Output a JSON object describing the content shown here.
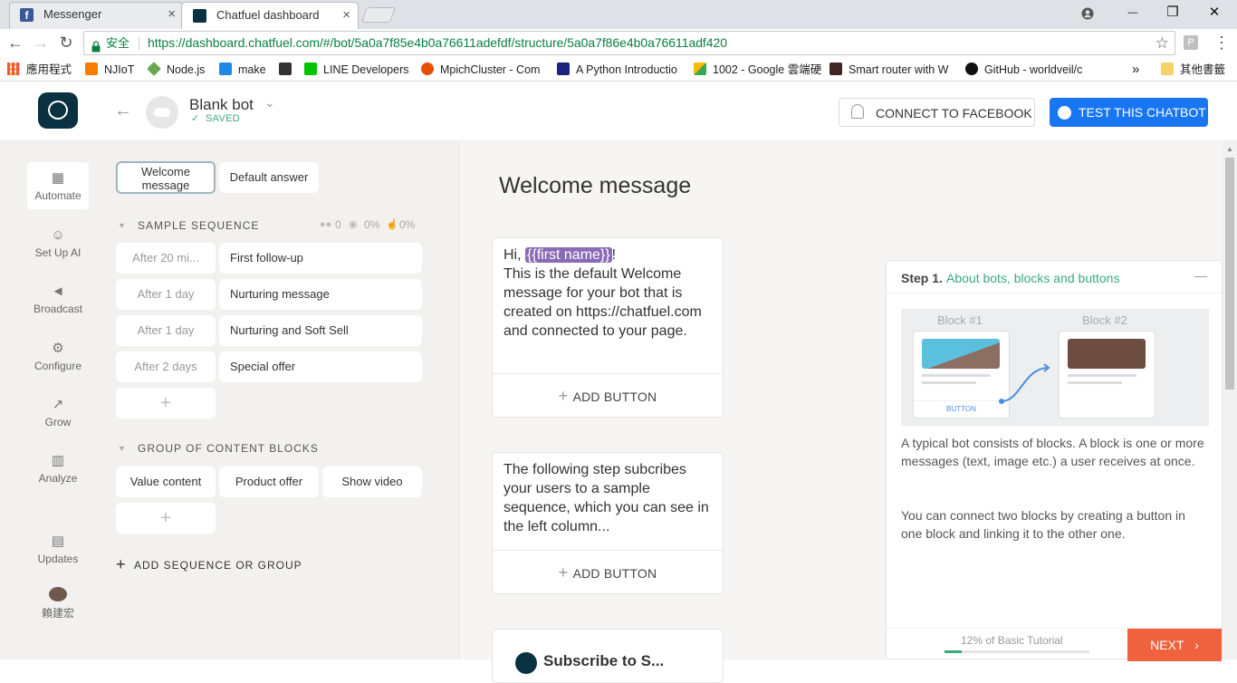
{
  "browser": {
    "tabs": [
      {
        "title": "Messenger",
        "close": "×"
      },
      {
        "title": "Chatfuel dashboard",
        "close": "×"
      }
    ],
    "window_controls": {
      "minimize": "—",
      "maximize": "❐",
      "close": "✕"
    },
    "address": {
      "secure_label": "安全",
      "url": "https://dashboard.chatfuel.com/#/bot/5a0a7f85e4b0a76611adefdf/structure/5a0a7f86e4b0a76611adf420"
    },
    "bookmarks": [
      {
        "label": "應用程式",
        "color": "#e8453c"
      },
      {
        "label": "NJIoT",
        "color": "#f57c00"
      },
      {
        "label": "Node.js",
        "color": "#6aa84f"
      },
      {
        "label": "make",
        "color": "#1e88e5"
      },
      {
        "label": "",
        "color": "#333333"
      },
      {
        "label": "LINE Developers",
        "color": "#00c300"
      },
      {
        "label": "MpichCluster - Com",
        "color": "#e65100"
      },
      {
        "label": "A Python Introductio",
        "color": "#1a237e"
      },
      {
        "label": "1002 - Google 雲端硬",
        "color": "#fbbc05"
      },
      {
        "label": "Smart router with W",
        "color": "#3e2723"
      },
      {
        "label": "GitHub - worldveil/c",
        "color": "#111111"
      }
    ],
    "bookmarks_overflow": "»",
    "other_bookmarks": "其他書籤"
  },
  "header": {
    "bot_name": "Blank bot",
    "status": "SAVED",
    "connect_label": "CONNECT TO FACEBOOK",
    "test_label": "TEST THIS CHATBOT"
  },
  "nav": [
    {
      "label": "Automate",
      "icon": "automate-icon"
    },
    {
      "label": "Set Up AI",
      "icon": "ai-icon"
    },
    {
      "label": "Broadcast",
      "icon": "broadcast-icon"
    },
    {
      "label": "Configure",
      "icon": "gear-icon"
    },
    {
      "label": "Grow",
      "icon": "grow-icon"
    },
    {
      "label": "Analyze",
      "icon": "analyze-icon"
    },
    {
      "label": "Updates",
      "icon": "updates-icon"
    },
    {
      "label": "賴建宏",
      "icon": "avatar"
    }
  ],
  "blocks": {
    "welcome_chip": "Welcome message",
    "default_chip": "Default answer",
    "sequence": {
      "title": "SAMPLE SEQUENCE",
      "stats": {
        "users": "0",
        "views": "0%",
        "clicks": "0%"
      },
      "rows": [
        {
          "delay": "After 20 mi...",
          "name": "First follow-up"
        },
        {
          "delay": "After 1 day",
          "name": "Nurturing message"
        },
        {
          "delay": "After 1 day",
          "name": "Nurturing and Soft Sell"
        },
        {
          "delay": "After 2 days",
          "name": "Special offer"
        }
      ],
      "add": "+"
    },
    "group": {
      "title": "GROUP OF CONTENT BLOCKS",
      "items": [
        "Value content",
        "Product offer",
        "Show video"
      ],
      "add": "+"
    },
    "add_sequence": "ADD SEQUENCE OR GROUP"
  },
  "editor": {
    "title": "Welcome message",
    "card1": {
      "greeting": "Hi, ",
      "tag": "{{first name}}",
      "tag_suffix": "!",
      "body": "This is the default Welcome message for your bot that is created on https://chatfuel.com and connected to your page.",
      "add_button": "ADD BUTTON"
    },
    "card2": {
      "body": "The following step subcribes your users to a sample sequence, which you can see in the left column...",
      "add_button": "ADD BUTTON"
    },
    "card3_title": "Subscribe to S..."
  },
  "tutorial": {
    "step_prefix": "Step 1.",
    "step_title": "About bots, blocks and buttons",
    "collapse": "—",
    "illustration": {
      "block1": "Block #1",
      "block2": "Block #2",
      "button": "BUTTON"
    },
    "para1": "A typical bot consists of blocks. A block is one or more messages (text, image etc.) a user receives at once.",
    "para2": "You can connect two blocks by creating a button in one block and linking it to the other one.",
    "progress_label": "12% of Basic Tutorial",
    "progress_fraction": 0.12,
    "next_label": "NEXT"
  },
  "colors": {
    "brand_dark": "#0a3142",
    "accent_blue": "#1876f2",
    "accent_green": "#3aaa7b",
    "next_orange": "#f0623d",
    "tag_purple": "#8a6bb5"
  }
}
